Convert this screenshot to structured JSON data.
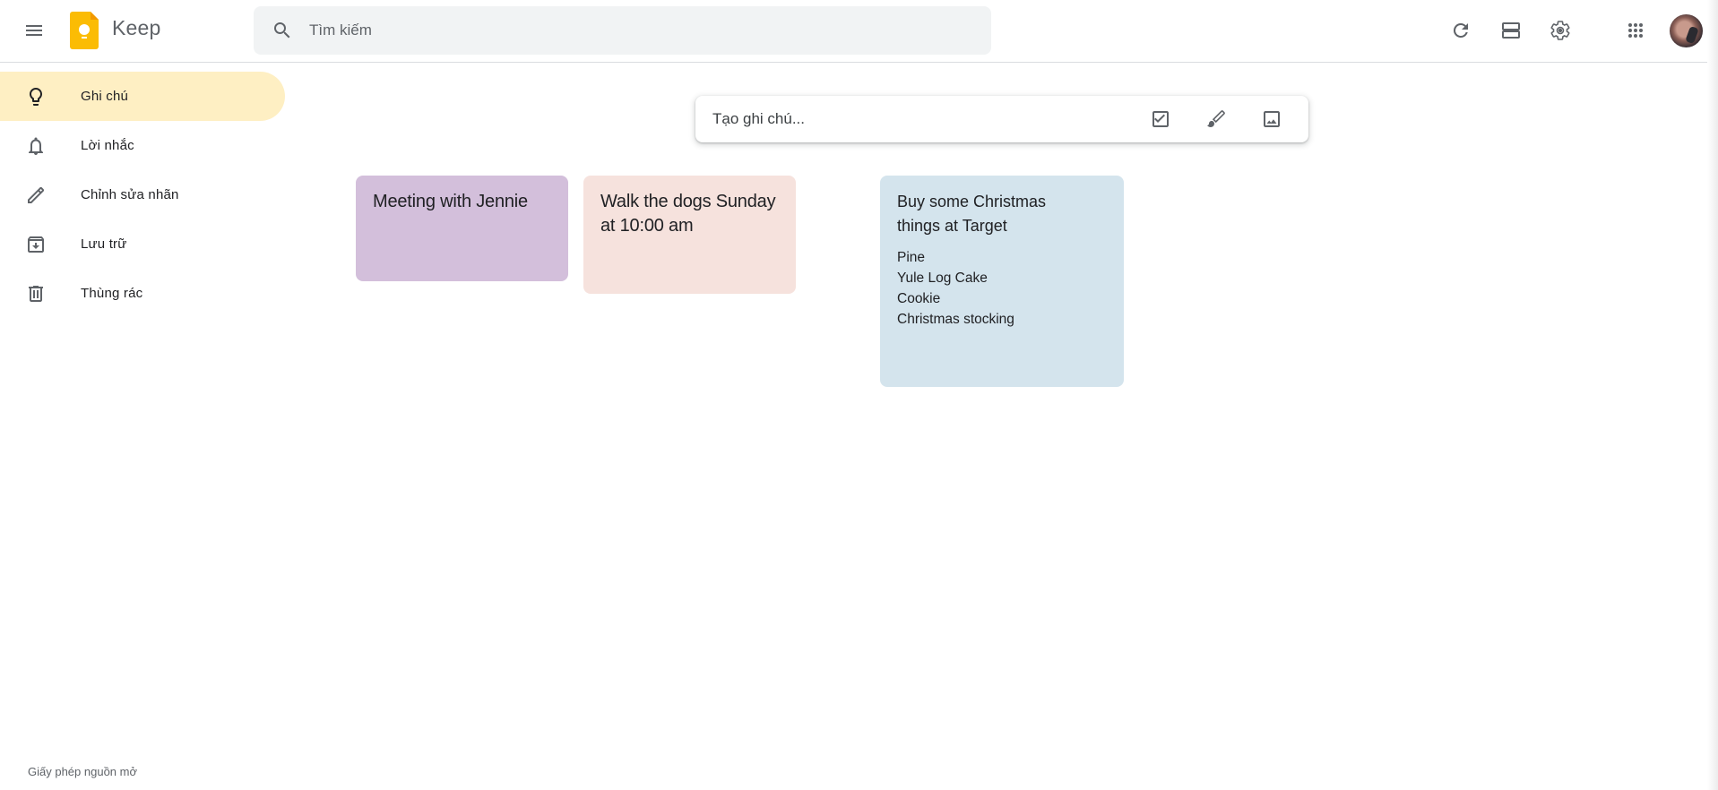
{
  "header": {
    "menu_icon": "hamburger-menu-icon",
    "app_title": "Keep",
    "logo_icon": "keep-logo-icon",
    "search": {
      "placeholder": "Tìm kiếm",
      "value": "",
      "icon": "search-icon"
    },
    "actions": [
      {
        "name": "refresh",
        "icon": "refresh-icon"
      },
      {
        "name": "list-view",
        "icon": "list-view-icon"
      },
      {
        "name": "settings",
        "icon": "gear-icon"
      },
      {
        "name": "apps",
        "icon": "apps-grid-icon"
      },
      {
        "name": "account",
        "icon": "avatar"
      }
    ]
  },
  "sidebar": {
    "items": [
      {
        "label": "Ghi chú",
        "icon": "lightbulb-icon",
        "active": true
      },
      {
        "label": "Lời nhắc",
        "icon": "bell-icon",
        "active": false
      },
      {
        "label": "Chỉnh sửa nhãn",
        "icon": "pencil-icon",
        "active": false
      },
      {
        "label": "Lưu trữ",
        "icon": "archive-icon",
        "active": false
      },
      {
        "label": "Thùng rác",
        "icon": "trash-icon",
        "active": false
      }
    ],
    "footer_link": "Giấy phép nguồn mở"
  },
  "take_note": {
    "placeholder": "Tạo ghi chú...",
    "actions": [
      {
        "name": "new-list",
        "icon": "checkbox-icon"
      },
      {
        "name": "new-drawing",
        "icon": "brush-icon"
      },
      {
        "name": "new-image",
        "icon": "image-icon"
      }
    ]
  },
  "notes": [
    {
      "title": "Meeting with Jennie",
      "body": [],
      "color": "#d3bfdb"
    },
    {
      "title": "Walk the dogs Sunday at 10:00 am",
      "title_lines": [
        "Walk the dogs Sunday",
        "at 10:00 am"
      ],
      "body": [],
      "color": "#f6e2dd"
    },
    {
      "title": "Buy some Christmas things at Target",
      "title_lines": [
        "Buy some Christmas",
        "things at Target"
      ],
      "body": [
        "Pine",
        "Yule Log Cake",
        "Cookie",
        "Christmas stocking"
      ],
      "color": "#d4e4ed"
    }
  ],
  "colors": {
    "active_nav": "#feefc3",
    "search_bg": "#f1f3f4",
    "logo_yellow": "#fbbc04",
    "icon_gray": "#5f6368"
  }
}
